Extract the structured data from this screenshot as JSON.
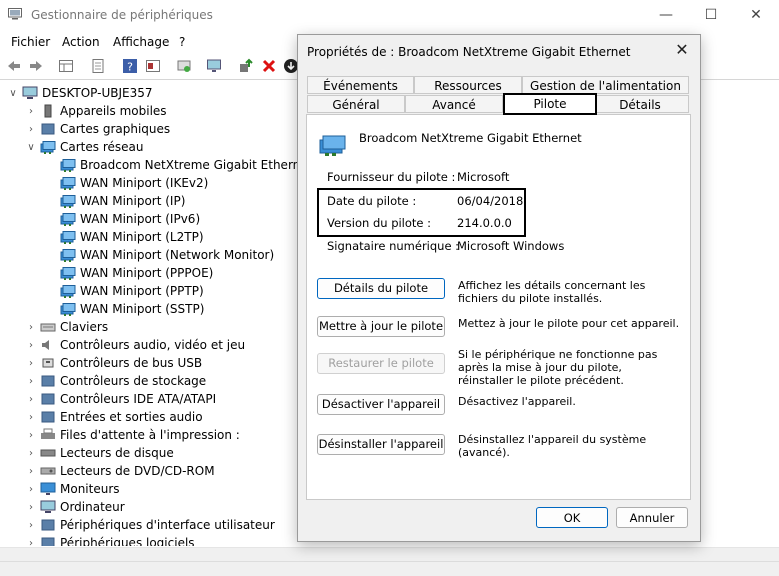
{
  "window": {
    "title": "Gestionnaire de périphériques",
    "min_glyph": "—",
    "max_glyph": "☐",
    "close_glyph": "✕"
  },
  "menu": [
    "Fichier",
    "Action",
    "Affichage",
    "?"
  ],
  "tree": [
    {
      "label": "DESKTOP-UBJE357",
      "level": 0,
      "toggle": "∨",
      "icon": "computer-icon"
    },
    {
      "label": "Appareils mobiles",
      "level": 1,
      "toggle": "›",
      "icon": "mobile-icon"
    },
    {
      "label": "Cartes graphiques",
      "level": 1,
      "toggle": "›",
      "icon": "display-adapter-icon"
    },
    {
      "label": "Cartes réseau",
      "level": 1,
      "toggle": "∨",
      "icon": "network-adapter-icon"
    },
    {
      "label": "Broadcom NetXtreme Gigabit Ethernet",
      "level": 2,
      "toggle": "",
      "icon": "network-adapter-icon"
    },
    {
      "label": "WAN Miniport (IKEv2)",
      "level": 2,
      "toggle": "",
      "icon": "network-adapter-icon"
    },
    {
      "label": "WAN Miniport (IP)",
      "level": 2,
      "toggle": "",
      "icon": "network-adapter-icon"
    },
    {
      "label": "WAN Miniport (IPv6)",
      "level": 2,
      "toggle": "",
      "icon": "network-adapter-icon"
    },
    {
      "label": "WAN Miniport (L2TP)",
      "level": 2,
      "toggle": "",
      "icon": "network-adapter-icon"
    },
    {
      "label": "WAN Miniport (Network Monitor)",
      "level": 2,
      "toggle": "",
      "icon": "network-adapter-icon"
    },
    {
      "label": "WAN Miniport (PPPOE)",
      "level": 2,
      "toggle": "",
      "icon": "network-adapter-icon"
    },
    {
      "label": "WAN Miniport (PPTP)",
      "level": 2,
      "toggle": "",
      "icon": "network-adapter-icon"
    },
    {
      "label": "WAN Miniport (SSTP)",
      "level": 2,
      "toggle": "",
      "icon": "network-adapter-icon"
    },
    {
      "label": "Claviers",
      "level": 1,
      "toggle": "›",
      "icon": "keyboard-icon"
    },
    {
      "label": "Contrôleurs audio, vidéo et jeu",
      "level": 1,
      "toggle": "›",
      "icon": "speaker-icon"
    },
    {
      "label": "Contrôleurs de bus USB",
      "level": 1,
      "toggle": "›",
      "icon": "usb-icon"
    },
    {
      "label": "Contrôleurs de stockage",
      "level": 1,
      "toggle": "›",
      "icon": "storage-icon"
    },
    {
      "label": "Contrôleurs IDE ATA/ATAPI",
      "level": 1,
      "toggle": "›",
      "icon": "ide-icon"
    },
    {
      "label": "Entrées et sorties audio",
      "level": 1,
      "toggle": "›",
      "icon": "audio-io-icon"
    },
    {
      "label": "Files d'attente à l'impression :",
      "level": 1,
      "toggle": "›",
      "icon": "printer-icon"
    },
    {
      "label": "Lecteurs de disque",
      "level": 1,
      "toggle": "›",
      "icon": "disk-drive-icon"
    },
    {
      "label": "Lecteurs de DVD/CD-ROM",
      "level": 1,
      "toggle": "›",
      "icon": "dvd-icon"
    },
    {
      "label": "Moniteurs",
      "level": 1,
      "toggle": "›",
      "icon": "monitor-icon"
    },
    {
      "label": "Ordinateur",
      "level": 1,
      "toggle": "›",
      "icon": "computer-icon"
    },
    {
      "label": "Périphériques d'interface utilisateur",
      "level": 1,
      "toggle": "›",
      "icon": "hid-icon"
    },
    {
      "label": "Périphériques logiciels",
      "level": 1,
      "toggle": "›",
      "icon": "software-device-icon"
    }
  ],
  "dialog": {
    "title": "Propriétés de : Broadcom NetXtreme Gigabit Ethernet",
    "close_glyph": "✕",
    "tabs_row1": [
      "Événements",
      "Ressources",
      "Gestion de l'alimentation"
    ],
    "tabs_row2": [
      "Général",
      "Avancé",
      "Pilote",
      "Détails"
    ],
    "active_tab": "Pilote",
    "device_name": "Broadcom NetXtreme Gigabit Ethernet",
    "props": [
      {
        "label": "Fournisseur du pilote :",
        "value": "Microsoft"
      },
      {
        "label": "Date du pilote :",
        "value": "06/04/2018"
      },
      {
        "label": "Version du pilote :",
        "value": "214.0.0.0"
      },
      {
        "label": "Signataire numérique :",
        "value": "Microsoft Windows"
      }
    ],
    "actions": [
      {
        "label": "Détails du pilote",
        "desc": "Affichez les détails concernant les fichiers du pilote installés.",
        "enabled": true
      },
      {
        "label": "Mettre à jour le pilote",
        "desc": "Mettez à jour le pilote pour cet appareil.",
        "enabled": true
      },
      {
        "label": "Restaurer le pilote",
        "desc": "Si le périphérique ne fonctionne pas après la mise à jour du pilote, réinstaller le pilote précédent.",
        "enabled": false
      },
      {
        "label": "Désactiver l'appareil",
        "desc": "Désactivez l'appareil.",
        "enabled": true
      },
      {
        "label": "Désinstaller l'appareil",
        "desc": "Désinstallez l'appareil du système (avancé).",
        "enabled": true
      }
    ],
    "ok_label": "OK",
    "cancel_label": "Annuler"
  },
  "colors": {
    "accent": "#0067c0",
    "network_icon": "#3a8fd6",
    "folder_icon": "#5a7fa8"
  }
}
